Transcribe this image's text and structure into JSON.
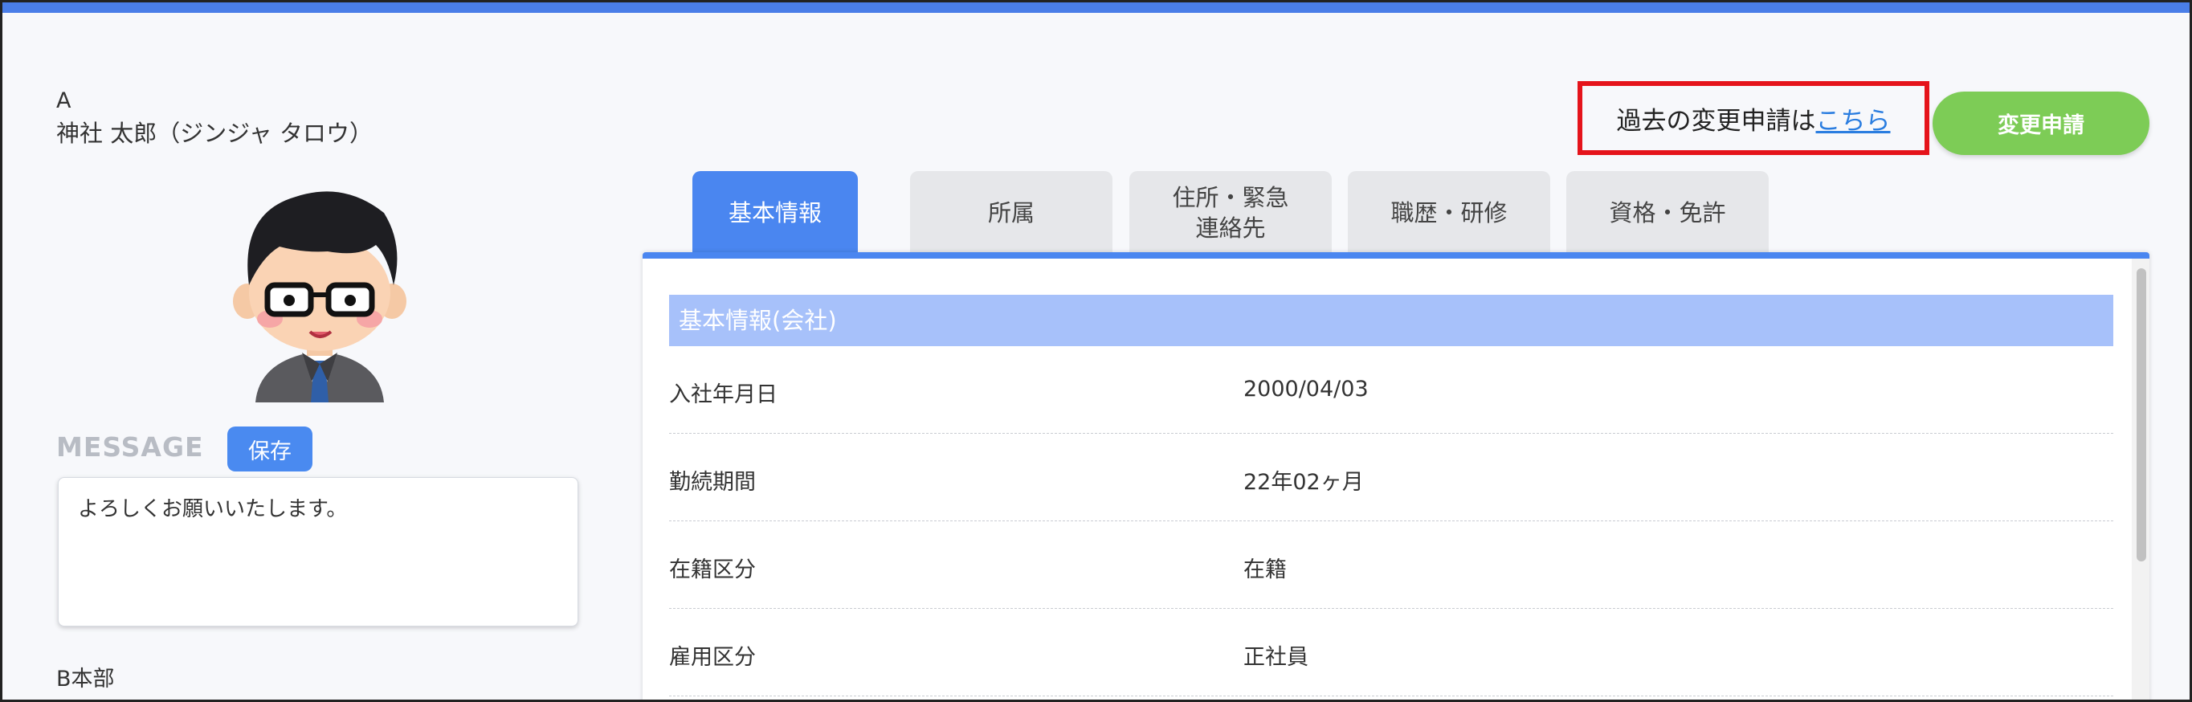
{
  "profile": {
    "company": "A",
    "name": "神社 太郎（ジンジャ タロウ）",
    "message_label": "MESSAGE",
    "save_label": "保存",
    "message_text": "よろしくお願いいたします。",
    "department": "B本部"
  },
  "header": {
    "history_text": "過去の変更申請は",
    "history_link": "こちら",
    "change_button": "変更申請"
  },
  "tabs": [
    {
      "label": "基本情報",
      "active": true
    },
    {
      "label": "所属",
      "active": false
    },
    {
      "label": "住所・緊急\n連絡先",
      "active": false
    },
    {
      "label": "職歴・研修",
      "active": false
    },
    {
      "label": "資格・免許",
      "active": false
    }
  ],
  "panel": {
    "section_title": "基本情報(会社)",
    "rows": [
      {
        "label": "入社年月日",
        "value": "2000/04/03"
      },
      {
        "label": "勤続期間",
        "value": "22年02ヶ月"
      },
      {
        "label": "在籍区分",
        "value": "在籍"
      },
      {
        "label": "雇用区分",
        "value": "正社員"
      }
    ]
  },
  "colors": {
    "accent": "#4a86f0",
    "section_header": "#a7c1fa",
    "change_button": "#7dcc56",
    "highlight_border": "#e5141b",
    "link": "#2a7de0"
  },
  "icons": [
    "avatar-illustration"
  ]
}
